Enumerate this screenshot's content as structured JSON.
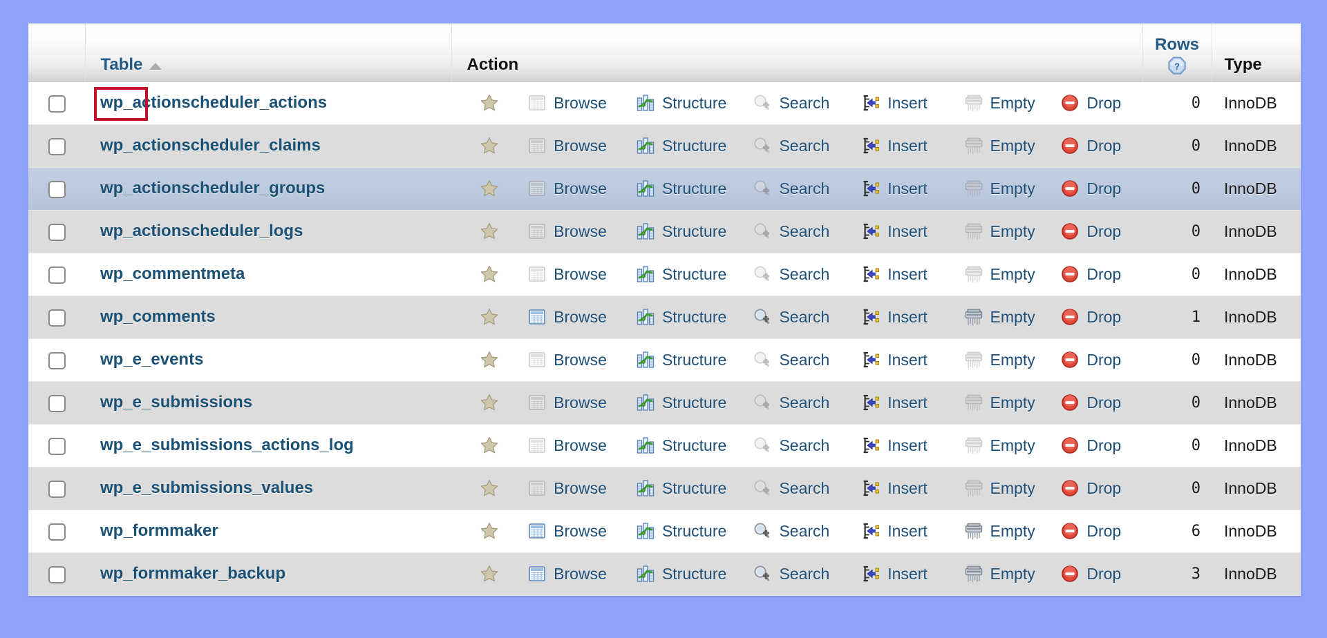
{
  "page": {
    "background_color": "#8ea4fa",
    "panel_background": "#ffffff"
  },
  "header": {
    "checkbox_column": "",
    "table_label": "Table",
    "sort_indicator": "ascending",
    "action_label": "Action",
    "rows_label": "Rows",
    "rows_help_icon": "help-question-icon",
    "type_label": "Type"
  },
  "actions": {
    "favorite_label": "",
    "browse_label": "Browse",
    "structure_label": "Structure",
    "search_label": "Search",
    "insert_label": "Insert",
    "empty_label": "Empty",
    "drop_label": "Drop"
  },
  "highlight": {
    "target_text": "wp_",
    "color": "#c4112b",
    "row_index": 0
  },
  "colors": {
    "link": "#1c5176",
    "header_link": "#235a86",
    "drop_icon": "#e03b2f",
    "hover_row": "#bdcade",
    "stripe_row": "#dcdcdc"
  },
  "rows": [
    {
      "name": "wp_actionscheduler_actions",
      "rows": "0",
      "type": "InnoDB",
      "has_data": false,
      "stripe": "odd",
      "hover": false
    },
    {
      "name": "wp_actionscheduler_claims",
      "rows": "0",
      "type": "InnoDB",
      "has_data": false,
      "stripe": "even",
      "hover": false
    },
    {
      "name": "wp_actionscheduler_groups",
      "rows": "0",
      "type": "InnoDB",
      "has_data": false,
      "stripe": "odd",
      "hover": true
    },
    {
      "name": "wp_actionscheduler_logs",
      "rows": "0",
      "type": "InnoDB",
      "has_data": false,
      "stripe": "even",
      "hover": false
    },
    {
      "name": "wp_commentmeta",
      "rows": "0",
      "type": "InnoDB",
      "has_data": false,
      "stripe": "odd",
      "hover": false
    },
    {
      "name": "wp_comments",
      "rows": "1",
      "type": "InnoDB",
      "has_data": true,
      "stripe": "even",
      "hover": false
    },
    {
      "name": "wp_e_events",
      "rows": "0",
      "type": "InnoDB",
      "has_data": false,
      "stripe": "odd",
      "hover": false
    },
    {
      "name": "wp_e_submissions",
      "rows": "0",
      "type": "InnoDB",
      "has_data": false,
      "stripe": "even",
      "hover": false
    },
    {
      "name": "wp_e_submissions_actions_log",
      "rows": "0",
      "type": "InnoDB",
      "has_data": false,
      "stripe": "odd",
      "hover": false
    },
    {
      "name": "wp_e_submissions_values",
      "rows": "0",
      "type": "InnoDB",
      "has_data": false,
      "stripe": "even",
      "hover": false
    },
    {
      "name": "wp_formmaker",
      "rows": "6",
      "type": "InnoDB",
      "has_data": true,
      "stripe": "odd",
      "hover": false
    },
    {
      "name": "wp_formmaker_backup",
      "rows": "3",
      "type": "InnoDB",
      "has_data": true,
      "stripe": "even",
      "hover": false
    }
  ]
}
